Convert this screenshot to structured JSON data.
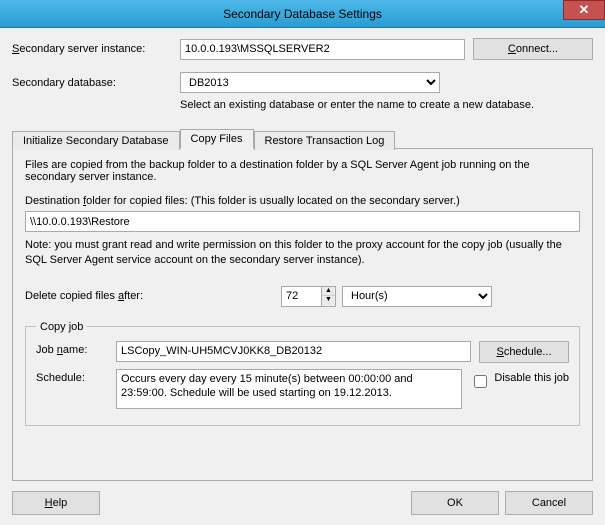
{
  "window": {
    "title": "Secondary Database Settings",
    "close_glyph": "✕"
  },
  "form": {
    "server_label_pre": "",
    "server_label": "Secondary server instance:",
    "server_u": "S",
    "server_value": "10.0.0.193\\MSSQLSERVER2",
    "connect_label": "Connect...",
    "connect_u": "C",
    "db_label": "Secondary database:",
    "db_selected": "DB2013",
    "db_hint": "Select an existing database or enter the name to create a new database."
  },
  "tabs": {
    "init": "Initialize Secondary Database",
    "copy": "Copy Files",
    "restore": "Restore Transaction Log"
  },
  "copy": {
    "intro": "Files are copied from the backup folder to a destination folder by a SQL Server Agent job running on the secondary server instance.",
    "dest_label_full": "Destination folder for copied files: (This folder is usually located on the secondary server.)",
    "dest_u": "f",
    "dest_value": "\\\\10.0.0.193\\Restore",
    "note": "Note: you must grant read and write permission on this folder to the proxy account for the copy job (usually the SQL Server Agent service account on the secondary server instance).",
    "delete_label_full": "Delete copied files after:",
    "delete_u": "a",
    "delete_value": "72",
    "delete_unit": "Hour(s)"
  },
  "copyjob": {
    "legend": "Copy job",
    "jobname_label": "Job name:",
    "jobname_u": "n",
    "jobname_value": "LSCopy_WIN-UH5MCVJ0KK8_DB20132",
    "schedule_btn": "Schedule...",
    "schedule_u": "S",
    "schedule_label": "Schedule:",
    "schedule_text": "Occurs every day every 15 minute(s) between 00:00:00 and 23:59:00. Schedule will be used starting on 19.12.2013.",
    "disable_label": "Disable this job"
  },
  "footer": {
    "help": "Help",
    "help_u": "H",
    "ok": "OK",
    "cancel": "Cancel"
  }
}
